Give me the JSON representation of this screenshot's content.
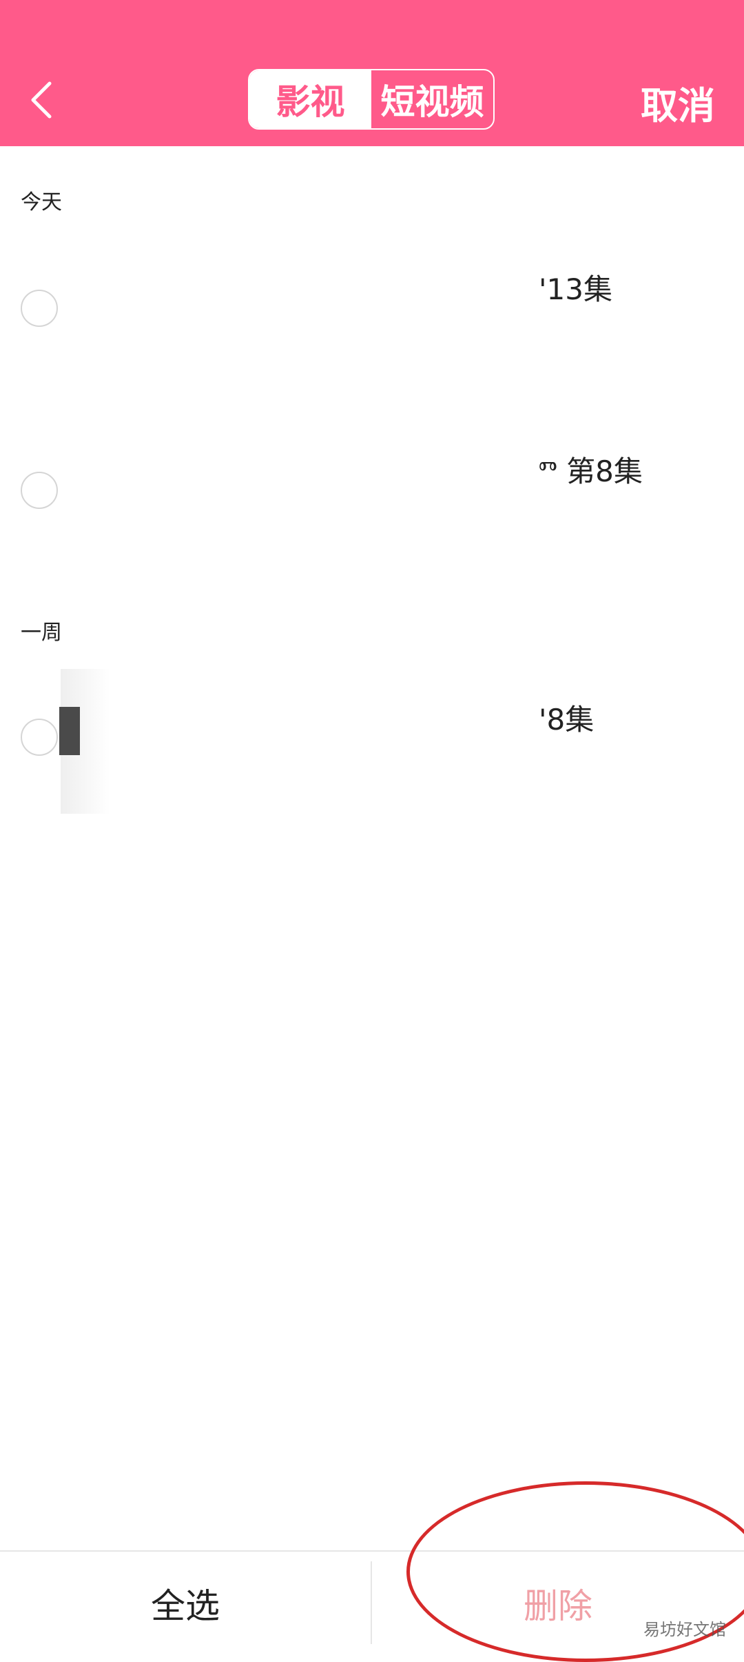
{
  "header": {
    "tabs": [
      {
        "label": "影视",
        "active": true
      },
      {
        "label": "短视频",
        "active": false
      }
    ],
    "cancel_label": "取消"
  },
  "sections": [
    {
      "label": "今天",
      "items": [
        {
          "title": "'13集"
        },
        {
          "title": "ⱅ  第8集"
        }
      ]
    },
    {
      "label": "一周",
      "items": [
        {
          "title": "'8集"
        }
      ]
    }
  ],
  "footer": {
    "select_all_label": "全选",
    "delete_label": "删除"
  },
  "watermark": "易坊好文馆",
  "colors": {
    "brand": "#ff5a8a",
    "delete_disabled": "#f0a0a6",
    "annotation": "#d62a2a"
  }
}
